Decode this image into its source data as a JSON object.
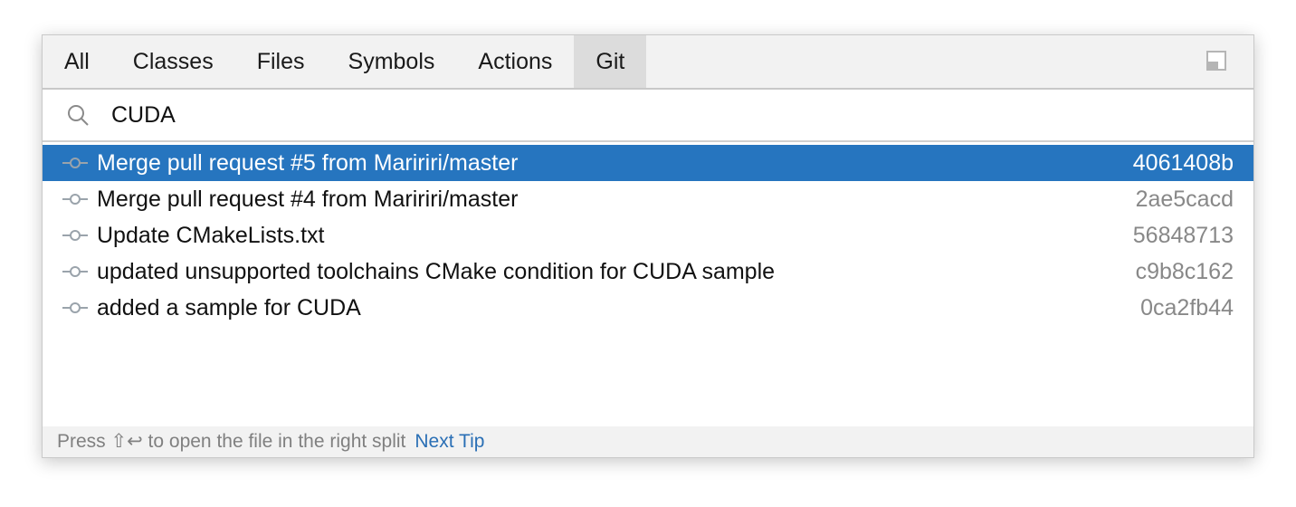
{
  "tabs": [
    "All",
    "Classes",
    "Files",
    "Symbols",
    "Actions",
    "Git"
  ],
  "active_tab": "Git",
  "search": {
    "value": "CUDA",
    "icon": "search-icon"
  },
  "results": [
    {
      "message": "Merge pull request #5 from Maririri/master",
      "hash": "4061408b",
      "selected": true
    },
    {
      "message": "Merge pull request #4 from Maririri/master",
      "hash": "2ae5cacd"
    },
    {
      "message": "Update CMakeLists.txt",
      "hash": "56848713"
    },
    {
      "message": "updated unsupported toolchains CMake condition for CUDA sample",
      "hash": "c9b8c162"
    },
    {
      "message": "added a sample for CUDA",
      "hash": "0ca2fb44"
    }
  ],
  "footer": {
    "tip": "Press ⇧↩ to open the file in the right split",
    "next_tip": "Next Tip"
  },
  "colors": {
    "selection": "#2675bf",
    "link": "#2a6fb5"
  }
}
